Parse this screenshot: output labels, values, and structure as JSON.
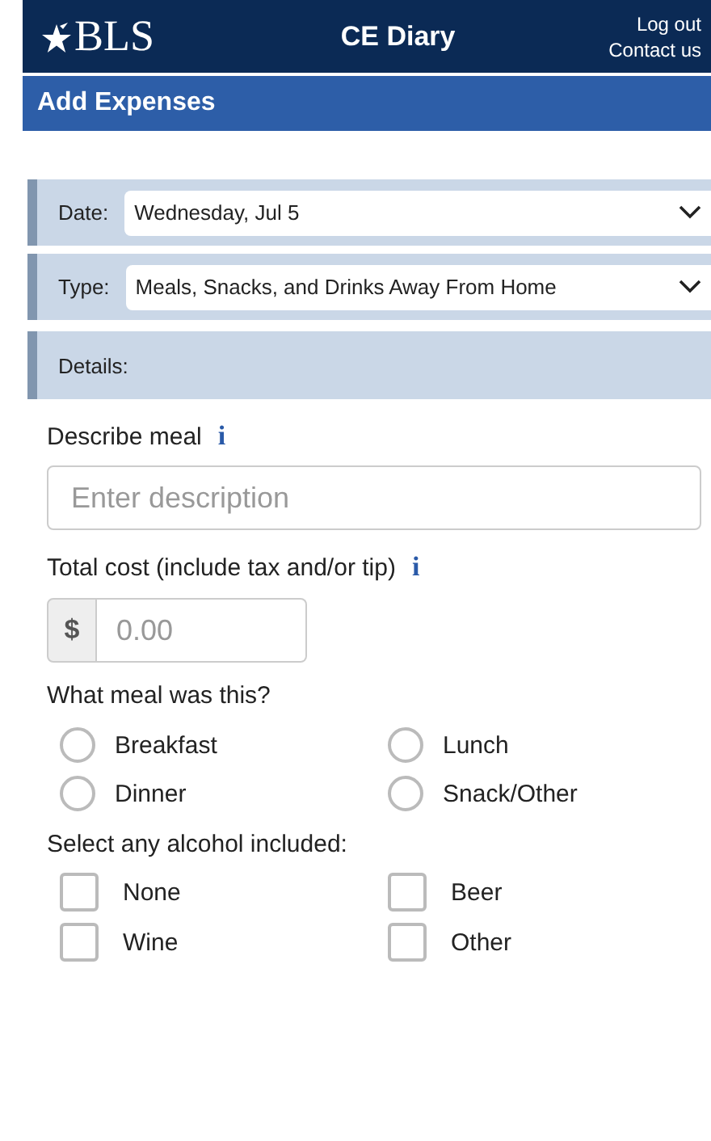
{
  "header": {
    "logo": "BLS",
    "title": "CE Diary",
    "links": [
      "Log out",
      "Contact us"
    ]
  },
  "page_title": "Add Expenses",
  "selects": [
    {
      "label": "Date:",
      "value": "Wednesday, Jul 5"
    },
    {
      "label": "Type:",
      "value": "Meals, Snacks, and Drinks Away From Home"
    }
  ],
  "details_label": "Details:",
  "describe": {
    "label": "Describe meal",
    "info": "i",
    "placeholder": "Enter description"
  },
  "cost": {
    "label": "Total cost (include tax and/or tip)",
    "info": "i",
    "prefix": "$",
    "placeholder": "0.00"
  },
  "meal": {
    "label": "What meal was this?",
    "options": [
      {
        "label": "Breakfast",
        "selected": false
      },
      {
        "label": "Lunch",
        "selected": false
      },
      {
        "label": "Dinner",
        "selected": false
      },
      {
        "label": "Snack/Other",
        "selected": false
      }
    ]
  },
  "alcohol": {
    "label": "Select any alcohol included:",
    "options": [
      {
        "label": "None",
        "checked": false
      },
      {
        "label": "Beer",
        "checked": false
      },
      {
        "label": "Wine",
        "checked": false
      },
      {
        "label": "Other",
        "checked": false
      }
    ]
  }
}
